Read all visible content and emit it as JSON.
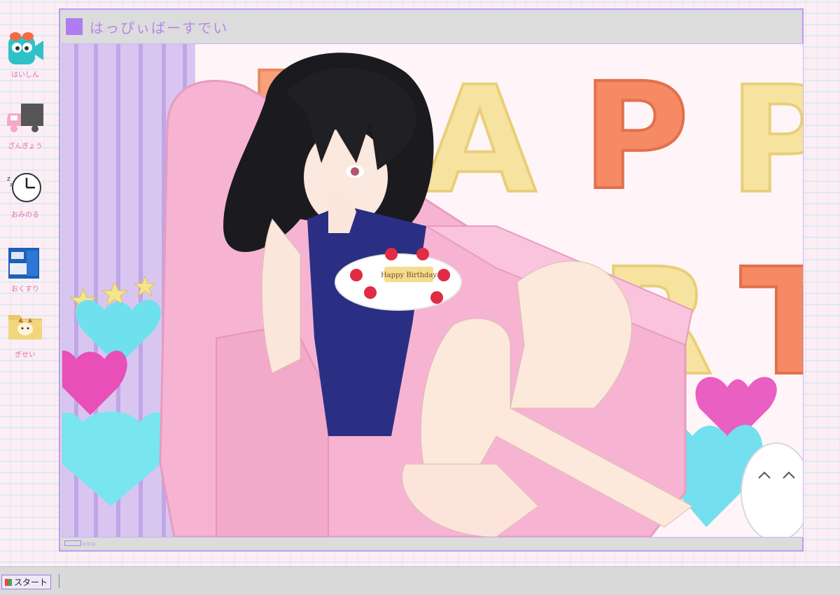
{
  "desktop": {
    "icons": [
      {
        "name": "haishin",
        "label": "はいしん",
        "icon": "video-camera-icon"
      },
      {
        "name": "zangyou",
        "label": "ざんぎょう",
        "icon": "truck-icon"
      },
      {
        "name": "omimoru",
        "label": "おみのる",
        "icon": "clock-icon"
      },
      {
        "name": "okusuri",
        "label": "おくすり",
        "icon": "medicine-box-icon"
      },
      {
        "name": "gisei",
        "label": "ぎせい",
        "icon": "cat-folder-icon"
      }
    ]
  },
  "window": {
    "title": "はっぴぃばーすでい",
    "title_icon": "purple-square-icon"
  },
  "artwork": {
    "balloon_letters_row1": [
      "H",
      "A",
      "P",
      "P"
    ],
    "balloon_letters_row2": [
      "R",
      "T"
    ],
    "cake_plaque": "Happy Birthday"
  },
  "taskbar": {
    "start_label": "スタート",
    "start_icon": "start-flag-icon"
  },
  "colors": {
    "window_border": "#b79cf2",
    "title_text": "#b488e8",
    "desktop_label": "#e070a8",
    "chair_pink": "#f6b4d2",
    "swimsuit_navy": "#2a2f84"
  }
}
